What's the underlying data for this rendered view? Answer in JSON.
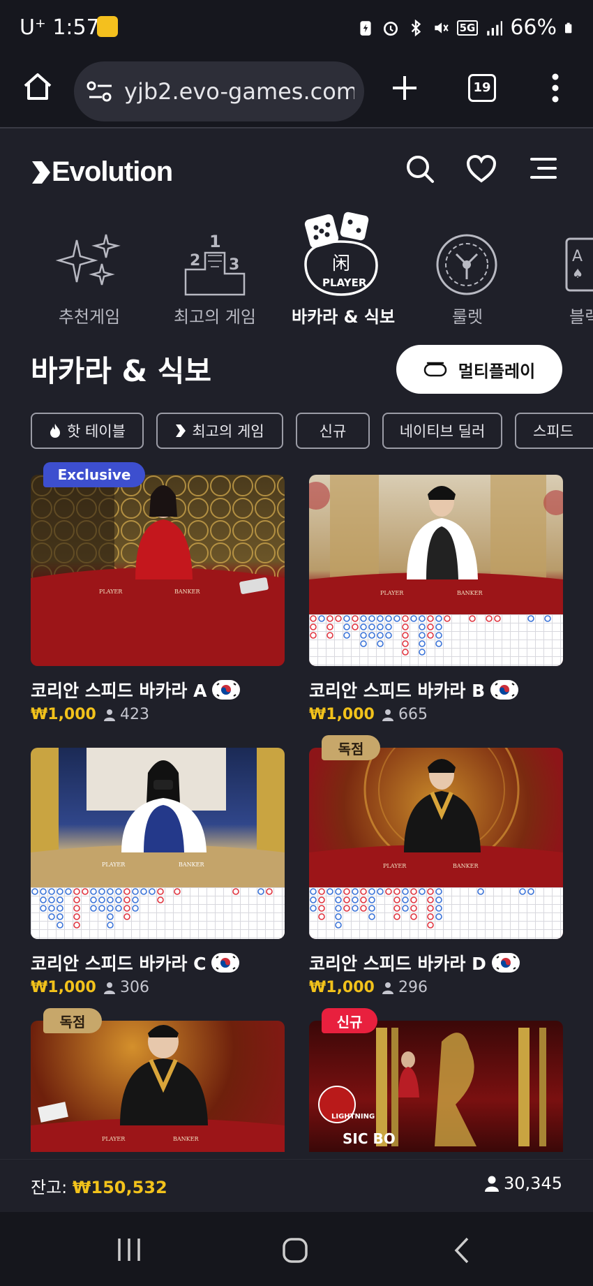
{
  "status_bar": {
    "carrier": "U⁺",
    "time": "1:57",
    "battery": "66%",
    "network": "5G"
  },
  "browser": {
    "url": "yjb2.evo-games.com",
    "tab_count": "19"
  },
  "brand": {
    "name": "Evolution"
  },
  "categories": [
    {
      "label": "추천게임",
      "icon": "sparkle-icon"
    },
    {
      "label": "최고의 게임",
      "icon": "podium-icon"
    },
    {
      "label": "바카라 & 식보",
      "icon": "dice-player-icon",
      "active": true
    },
    {
      "label": "룰렛",
      "icon": "roulette-icon"
    },
    {
      "label": "블랙",
      "icon": "playing-card-icon"
    }
  ],
  "section": {
    "title": "바카라 & 식보",
    "multiplay_label": "멀티플레이"
  },
  "filters": [
    "핫 테이블",
    "최고의 게임",
    "신규",
    "네이티브 딜러",
    "스피드"
  ],
  "games": [
    {
      "name": "코리안 스피드 바카라 A",
      "stake": "₩1,000",
      "players": "423",
      "badge": "Exclusive"
    },
    {
      "name": "코리안 스피드 바카라 B",
      "stake": "₩1,000",
      "players": "665",
      "badge": ""
    },
    {
      "name": "코리안 스피드 바카라 C",
      "stake": "₩1,000",
      "players": "306",
      "badge": ""
    },
    {
      "name": "코리안 스피드 바카라 D",
      "stake": "₩1,000",
      "players": "296",
      "badge": "독점"
    },
    {
      "name": "",
      "stake": "",
      "players": "",
      "badge": "독점"
    },
    {
      "name": "",
      "stake": "",
      "players": "",
      "badge": "신규"
    }
  ],
  "thumb_text": {
    "player": "PLAYER",
    "banker": "BANKER",
    "lightning": "LIGHTNING",
    "sicbo": "SIC BO"
  },
  "footer": {
    "balance_label": "잔고:",
    "balance_value": "₩150,532",
    "total_players": "30,345"
  },
  "colors": {
    "background": "#1f2029",
    "accent_gold": "#f2c21b",
    "exclusive_badge": "#3d4fcf",
    "new_badge": "#e8203e",
    "exclusive_gold_badge": "#c7a76a"
  }
}
